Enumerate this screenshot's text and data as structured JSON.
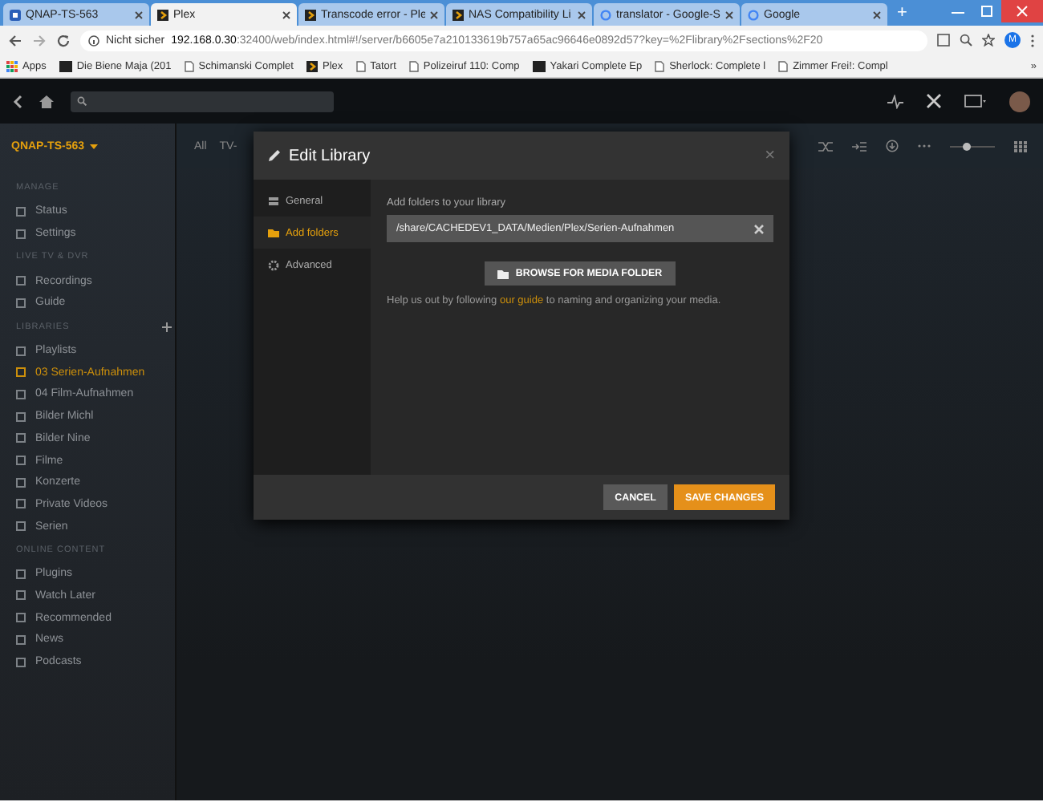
{
  "browser": {
    "tabs": [
      {
        "title": "QNAP-TS-563",
        "selected": false
      },
      {
        "title": "Plex",
        "selected": true
      },
      {
        "title": "Transcode error - Ple",
        "selected": false
      },
      {
        "title": "NAS Compatibility Li",
        "selected": false
      },
      {
        "title": "translator - Google-S",
        "selected": false
      },
      {
        "title": "Google",
        "selected": false
      }
    ],
    "new_tab": "+",
    "security": "Nicht sicher",
    "url_host": "192.168.0.30",
    "url_rest": ":32400/web/index.html#!/server/b6605e7a210133619b757a65ac96646e0892d57?key=%2Flibrary%2Fsections%2F20",
    "profile": "M",
    "bookmarks": [
      {
        "label": "Apps"
      },
      {
        "label": "Die Biene Maja (201"
      },
      {
        "label": "Schimanski Complet"
      },
      {
        "label": "Plex"
      },
      {
        "label": "Tatort"
      },
      {
        "label": "Polizeiruf 110: Comp"
      },
      {
        "label": "Yakari Complete Ep"
      },
      {
        "label": "Sherlock: Complete l"
      },
      {
        "label": "Zimmer Frei!: Compl"
      }
    ],
    "more_bookmarks": "»"
  },
  "plex": {
    "server": "QNAP-TS-563",
    "filters": [
      "All",
      "TV-"
    ],
    "size_slider": {
      "level": 0.35
    },
    "sidebar": [
      {
        "heading": "MANAGE",
        "items": [
          {
            "label": "Status",
            "selected": false
          },
          {
            "label": "Settings",
            "selected": false
          }
        ]
      },
      {
        "heading": "LIVE TV & DVR",
        "items": [
          {
            "label": "Recordings",
            "selected": false
          },
          {
            "label": "Guide",
            "selected": false
          }
        ]
      },
      {
        "heading": "LIBRARIES",
        "items": [
          {
            "label": "Playlists",
            "selected": false
          },
          {
            "label": "03 Serien-Aufnahmen",
            "selected": true
          },
          {
            "label": "04 Film-Aufnahmen",
            "selected": false
          },
          {
            "label": "Bilder Michl",
            "selected": false
          },
          {
            "label": "Bilder Nine",
            "selected": false
          },
          {
            "label": "Filme",
            "selected": false
          },
          {
            "label": "Konzerte",
            "selected": false
          },
          {
            "label": "Private Videos",
            "selected": false
          },
          {
            "label": "Serien",
            "selected": false
          }
        ]
      },
      {
        "heading": "ONLINE CONTENT",
        "items": [
          {
            "label": "Plugins",
            "selected": false
          },
          {
            "label": "Watch Later",
            "selected": false
          },
          {
            "label": "Recommended",
            "selected": false
          },
          {
            "label": "News",
            "selected": false
          },
          {
            "label": "Podcasts",
            "selected": false
          }
        ]
      }
    ]
  },
  "dialog": {
    "title": "Edit Library",
    "close": "×",
    "nav": [
      {
        "label": "General",
        "selected": false
      },
      {
        "label": "Add folders",
        "selected": true
      },
      {
        "label": "Advanced",
        "selected": false
      }
    ],
    "folder_label": "Add folders to your library",
    "folder_value": "/share/CACHEDEV1_DATA/Medien/Plex/Serien-Aufnahmen",
    "browse_button": "BROWSE FOR MEDIA FOLDER",
    "help_before": "Help us out by following",
    "help_link": "our guide",
    "help_after": "to naming and organizing your media.",
    "buttons": [
      {
        "label": "CANCEL",
        "kind": "secondary"
      },
      {
        "label": "SAVE CHANGES",
        "kind": "primary"
      }
    ]
  }
}
